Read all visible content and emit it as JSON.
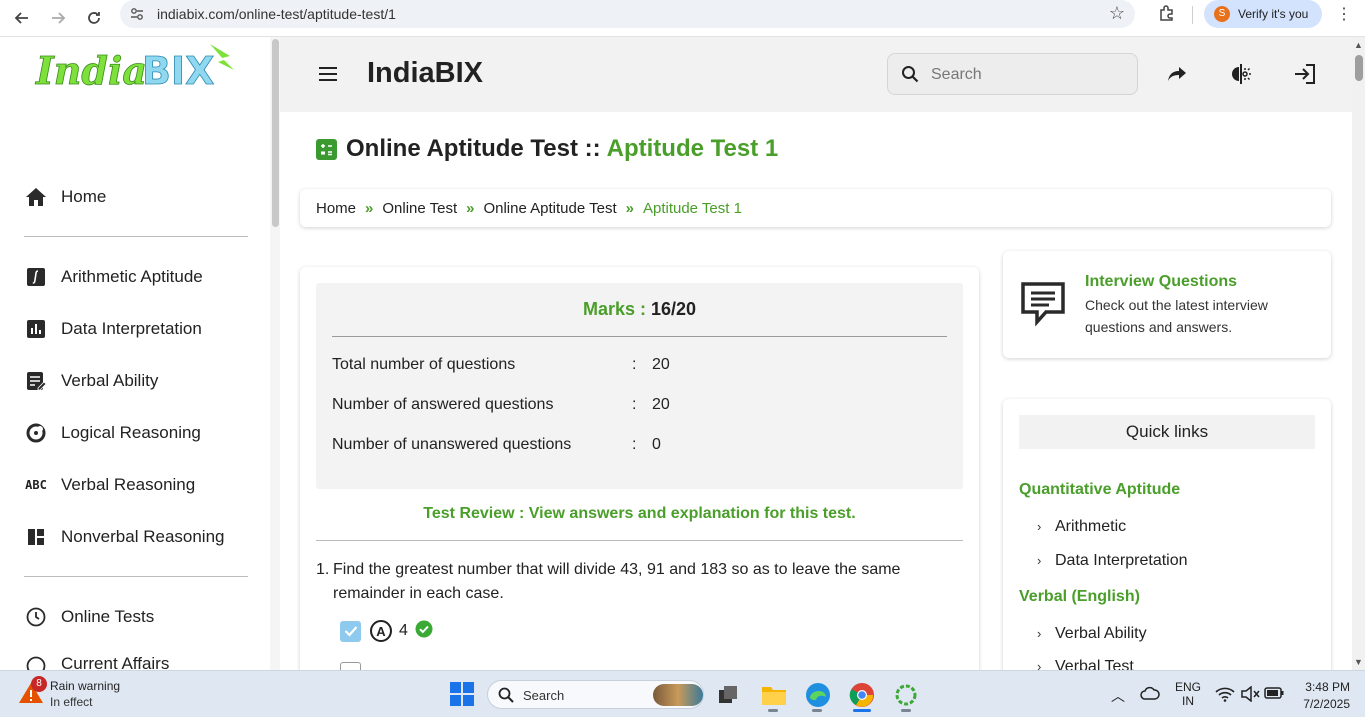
{
  "browser": {
    "url": "indiabix.com/online-test/aptitude-test/1",
    "verify_label": "Verify it's you",
    "avatar_initial": "S"
  },
  "sidebar": {
    "logo_text": "IndiaBIX",
    "items": [
      {
        "label": "Home",
        "icon": "home-icon"
      },
      {
        "label": "Arithmetic Aptitude",
        "icon": "integral-icon"
      },
      {
        "label": "Data Interpretation",
        "icon": "bar-chart-icon"
      },
      {
        "label": "Verbal Ability",
        "icon": "edit-note-icon"
      },
      {
        "label": "Logical Reasoning",
        "icon": "logic-icon"
      },
      {
        "label": "Verbal Reasoning",
        "icon": "abc-icon"
      },
      {
        "label": "Nonverbal Reasoning",
        "icon": "dashboard-icon"
      },
      {
        "label": "Online Tests",
        "icon": "clock-icon"
      },
      {
        "label": "Current Affairs",
        "icon": "globe-icon"
      }
    ],
    "abc_glyph": "ABC"
  },
  "header": {
    "brand": "IndiaBIX",
    "search_placeholder": "Search"
  },
  "page": {
    "title_main": "Online Aptitude Test ::",
    "title_sub": "Aptitude Test 1",
    "breadcrumbs": [
      "Home",
      "Online Test",
      "Online Aptitude Test",
      "Aptitude Test 1"
    ],
    "crumb_sep": "»"
  },
  "result": {
    "marks_label": "Marks :",
    "marks_value": "16/20",
    "rows": [
      {
        "label": "Total number of questions",
        "colon": ":",
        "value": "20"
      },
      {
        "label": "Number of answered questions",
        "colon": ":",
        "value": "20"
      },
      {
        "label": "Number of unanswered questions",
        "colon": ":",
        "value": "0"
      }
    ],
    "review_text": "Test Review : View answers and explanation for this test."
  },
  "question": {
    "number": "1.",
    "text": "Find the greatest number that will divide 43, 91 and 183 so as to leave the same remainder in each case.",
    "option_letter": "A",
    "option_value": "4"
  },
  "interview": {
    "title": "Interview Questions",
    "desc": "Check out the latest interview questions and answers."
  },
  "quick_links": {
    "heading": "Quick links",
    "categories": [
      {
        "title": "Quantitative Aptitude",
        "links": [
          "Arithmetic",
          "Data Interpretation"
        ]
      },
      {
        "title": "Verbal (English)",
        "links": [
          "Verbal Ability",
          "Verbal Test"
        ]
      }
    ]
  },
  "taskbar": {
    "weather_count": "8",
    "weather_title": "Rain warning",
    "weather_sub": "In effect",
    "search_placeholder": "Search",
    "lang_1": "ENG",
    "lang_2": "IN",
    "time": "3:48 PM",
    "date": "7/2/2025"
  },
  "colors": {
    "accent_green": "#4a9e2a",
    "header_bg": "#f2f2f2"
  }
}
